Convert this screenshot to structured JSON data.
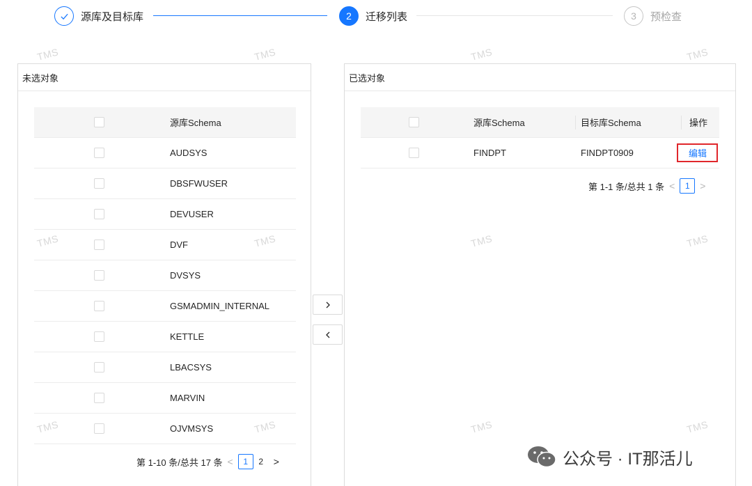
{
  "steps": [
    {
      "num": "✓",
      "title": "源库及目标库"
    },
    {
      "num": "2",
      "title": "迁移列表"
    },
    {
      "num": "3",
      "title": "预检查"
    }
  ],
  "watermark": "TMS",
  "left_panel": {
    "title": "未选对象",
    "header": "源库Schema",
    "rows": [
      "AUDSYS",
      "DBSFWUSER",
      "DEVUSER",
      "DVF",
      "DVSYS",
      "GSMADMIN_INTERNAL",
      "KETTLE",
      "LBACSYS",
      "MARVIN",
      "OJVMSYS"
    ],
    "pager": {
      "summary": "第 1-10 条/总共 17 条",
      "pages": [
        "1",
        "2"
      ]
    }
  },
  "right_panel": {
    "title": "已选对象",
    "headers": {
      "source": "源库Schema",
      "target": "目标库Schema",
      "action": "操作"
    },
    "rows": [
      {
        "source": "FINDPT",
        "target": "FINDPT0909",
        "action": "编辑"
      }
    ],
    "pager": {
      "summary": "第 1-1 条/总共 1 条",
      "pages": [
        "1"
      ]
    }
  },
  "transfer": {
    "to_right": ">",
    "to_left": "<"
  },
  "credit": "公众号 · IT那活儿",
  "colors": {
    "primary": "#1677ff",
    "highlight_border": "#e0262b"
  }
}
